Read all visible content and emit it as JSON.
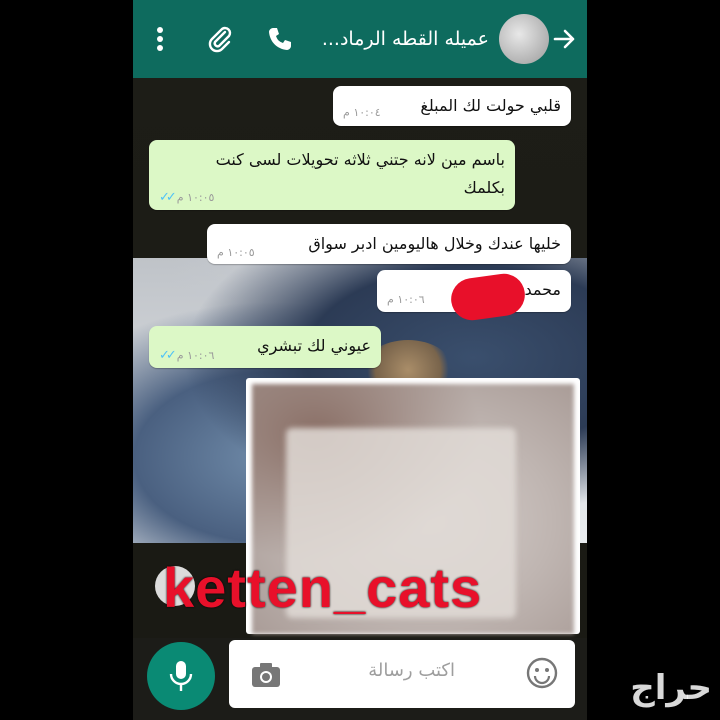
{
  "header": {
    "contact_name": "عميله القطه الرماد...",
    "icons": [
      "back-arrow-icon",
      "avatar",
      "phone-icon",
      "paperclip-icon",
      "more-vert-icon"
    ]
  },
  "messages": [
    {
      "direction": "incoming",
      "text": "قلبي حولت لك المبلغ",
      "time": "١٠:٠٤ م"
    },
    {
      "direction": "outgoing",
      "text": "باسم مين لانه جتني ثلاثه تحويلات لسى كنت بكلمك",
      "time": "١٠:٠٥ م",
      "read": true
    },
    {
      "direction": "incoming",
      "text": "خليها عندك وخلال هاليومين ادبر سواق",
      "time": "١٠:٠٥ م"
    },
    {
      "direction": "incoming",
      "text": "محمد",
      "time": "١٠:٠٦ م",
      "redacted": true
    },
    {
      "direction": "outgoing",
      "text": "عيوني لك تبشري",
      "time": "١٠:٠٦ م",
      "read": true
    }
  ],
  "watermark": "ketten_cats",
  "composer": {
    "placeholder": "اكتب رسالة",
    "icons": [
      "mic-icon",
      "camera-icon",
      "emoji-icon"
    ]
  },
  "corner_logo": "حراج",
  "colors": {
    "header": "#0e6b5e",
    "outgoing_bubble": "#dcf8c6",
    "incoming_bubble": "#ffffff",
    "mic_button": "#0a8a74",
    "watermark": "#e8102a",
    "read_ticks": "#4fc3f7"
  }
}
